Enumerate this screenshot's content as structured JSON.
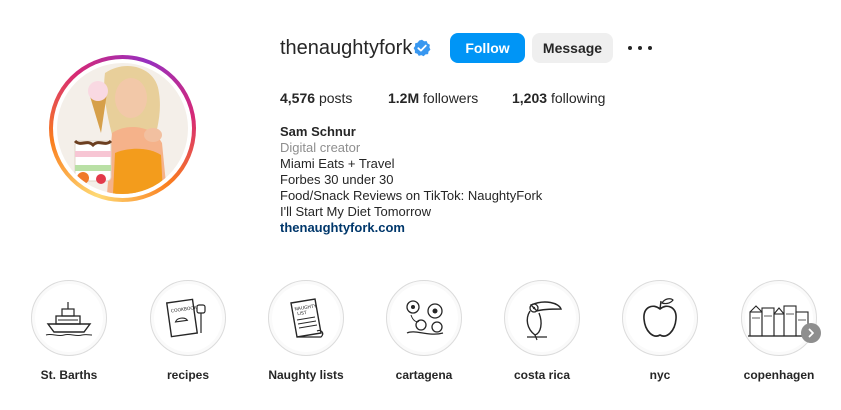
{
  "profile": {
    "username": "thenaughtyfork",
    "verified_icon": "verified-badge-icon",
    "follow_label": "Follow",
    "message_label": "Message",
    "more_icon": "more-options-icon",
    "accent_color": "#0095f6"
  },
  "stats": {
    "posts_count": "4,576",
    "posts_label": "posts",
    "followers_count": "1.2M",
    "followers_label": "followers",
    "following_count": "1,203",
    "following_label": "following"
  },
  "bio": {
    "name": "Sam Schnur",
    "category": "Digital creator",
    "lines": [
      "Miami Eats + Travel",
      "Forbes 30 under 30",
      "Food/Snack Reviews on TikTok: NaughtyFork",
      "I'll Start My Diet Tomorrow"
    ],
    "link": "thenaughtyfork.com"
  },
  "highlights": [
    {
      "label": "St. Barths",
      "icon": "boat-icon"
    },
    {
      "label": "recipes",
      "icon": "cookbook-icon"
    },
    {
      "label": "Naughty lists",
      "icon": "scroll-list-icon"
    },
    {
      "label": "cartagena",
      "icon": "flowers-icon"
    },
    {
      "label": "costa rica",
      "icon": "toucan-icon"
    },
    {
      "label": "nyc",
      "icon": "apple-icon"
    },
    {
      "label": "copenhagen",
      "icon": "buildings-icon"
    }
  ],
  "highlights_next_icon": "chevron-right-icon"
}
